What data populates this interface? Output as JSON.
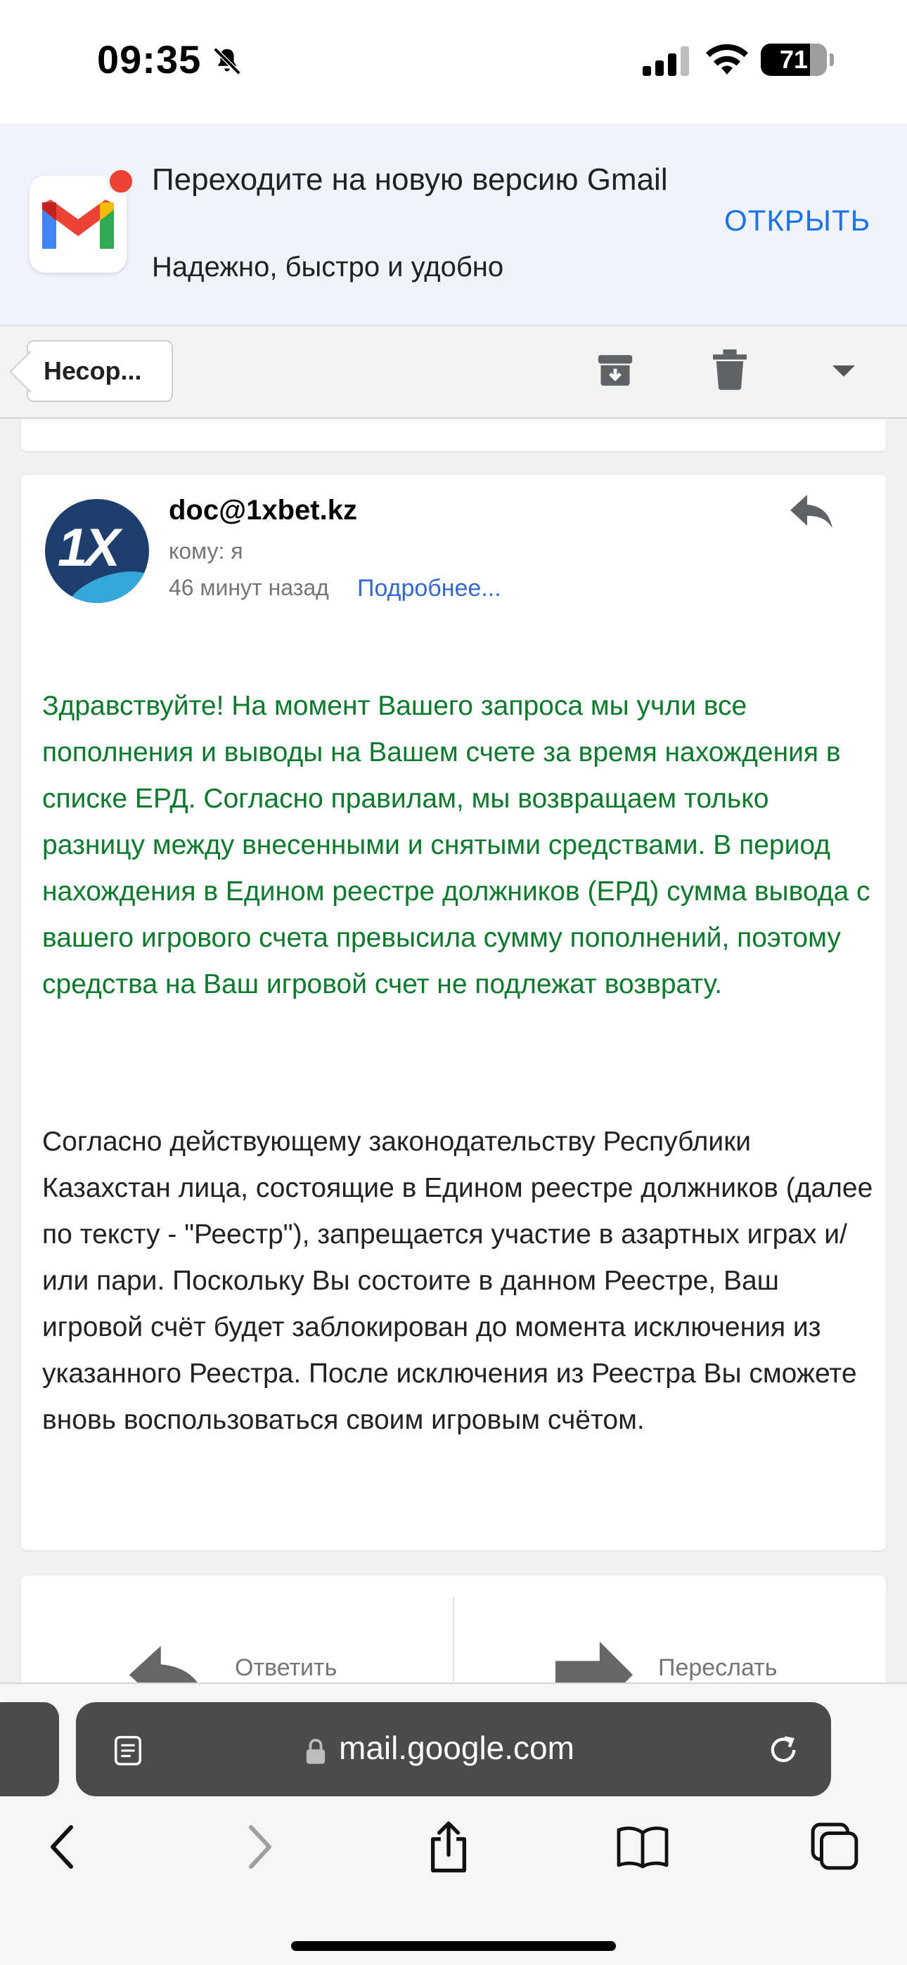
{
  "status_bar": {
    "time": "09:35",
    "battery": "71"
  },
  "banner": {
    "title": "Переходите на новую версию Gmail",
    "subtitle": "Надежно, быстро и удобно",
    "open_label": "ОТКРЫТЬ"
  },
  "toolbar": {
    "back_label": "Несор..."
  },
  "email": {
    "sender": "doc@1xbet.kz",
    "avatar_text": "1X",
    "to": "кому: я",
    "time_ago": "46 минут назад",
    "details_link": "Подробнее...",
    "paragraph_green": "Здравствуйте! На момент Вашего запроса мы учли все пополнения и выводы на Вашем счете за время нахождения в списке ЕРД. Согласно правилам, мы возвращаем только разницу между внесенными и снятыми средствами. В период нахождения в Едином реестре должников (ЕРД) сумма вывода с вашего игрового счета превысила сумму пополнений, поэтому средства на Ваш игровой счет не подлежат возврату.",
    "paragraph_black": "Согласно действующему законодательству Республики Казахстан лица, состоящие в Едином реестре должников (далее по тексту - \"Реестр\"), запрещается участие в азартных играх и/или пари. Поскольку Вы состоите в данном Реестре, Ваш игровой счёт будет заблокирован до момента исключения из указанного Реестра. После исключения из Реестра Вы сможете вновь воспользоваться своим игровым счётом."
  },
  "actions": {
    "reply_label": "Ответить",
    "forward_label": "Переслать"
  },
  "browser": {
    "url": "mail.google.com"
  },
  "colors": {
    "accent_link": "#1a73e8",
    "green_text": "#0b7a2c",
    "gmail_red": "#ea4335"
  }
}
